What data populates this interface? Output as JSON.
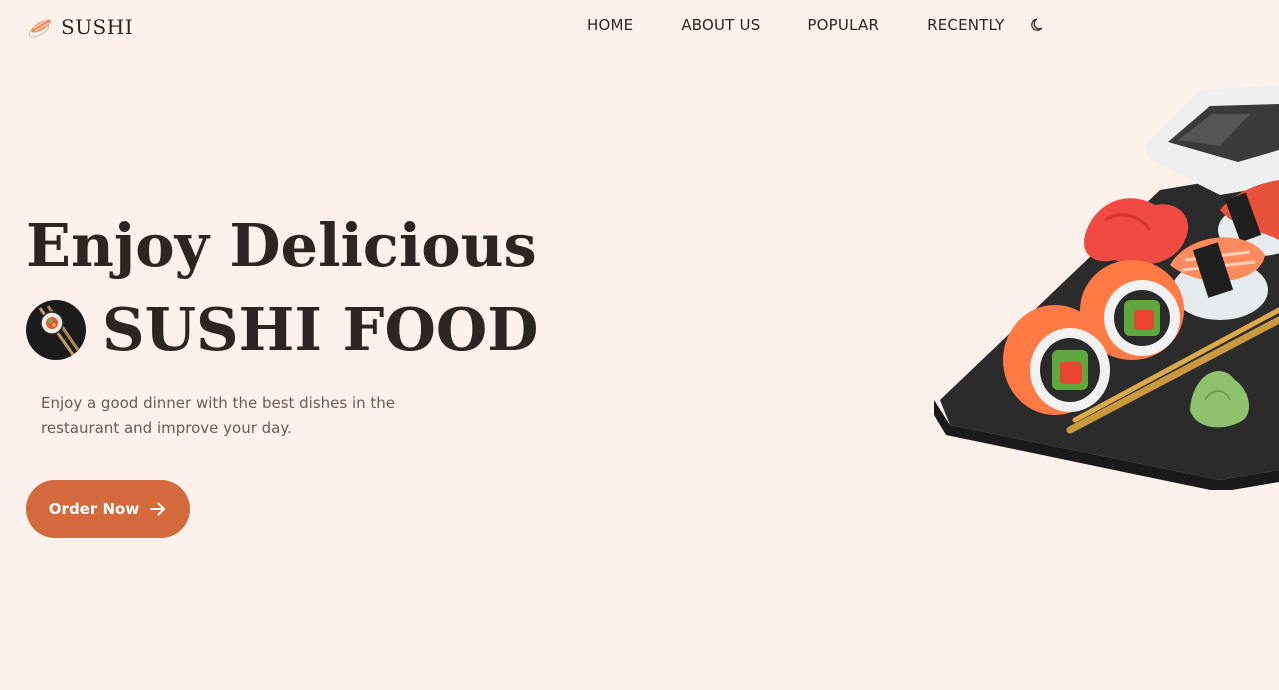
{
  "header": {
    "logo_text": "SUSHI",
    "nav": {
      "home": "HOME",
      "about": "ABOUT US",
      "popular": "POPULAR",
      "recently": "RECENTLY"
    },
    "theme_icon": "moon-icon"
  },
  "hero": {
    "title_line1": "Enjoy Delicious",
    "title_line2": "SUSHI FOOD",
    "description": "Enjoy a good dinner with the best dishes in the restaurant and improve your day.",
    "cta_label": "Order Now",
    "cta_icon": "arrow-right-icon"
  },
  "colors": {
    "background": "#fdf1ec",
    "text": "#2c2522",
    "accent": "#d4693c",
    "muted_text": "#6a5b55"
  }
}
